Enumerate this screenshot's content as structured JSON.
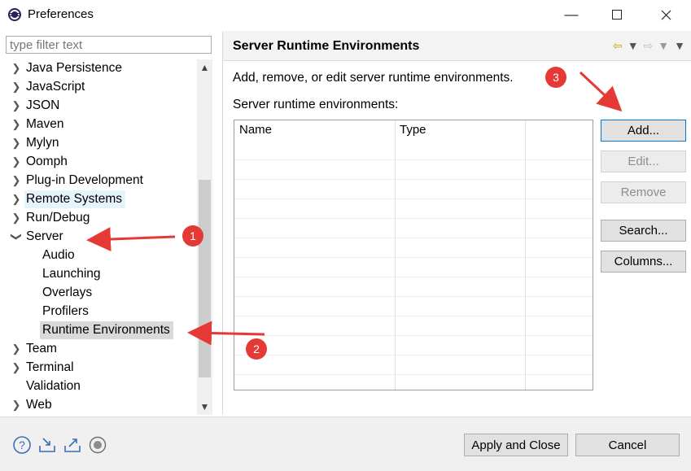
{
  "window": {
    "title": "Preferences",
    "controls": [
      "minimize-icon",
      "maximize-icon",
      "close-icon"
    ]
  },
  "filter": {
    "placeholder": "type filter text",
    "value": ""
  },
  "tree": {
    "items": [
      {
        "label": "Java Persistence",
        "expandable": true
      },
      {
        "label": "JavaScript",
        "expandable": true
      },
      {
        "label": "JSON",
        "expandable": true
      },
      {
        "label": "Maven",
        "expandable": true
      },
      {
        "label": "Mylyn",
        "expandable": true
      },
      {
        "label": "Oomph",
        "expandable": true
      },
      {
        "label": "Plug-in Development",
        "expandable": true
      },
      {
        "label": "Remote Systems",
        "expandable": true
      },
      {
        "label": "Run/Debug",
        "expandable": true
      },
      {
        "label": "Server",
        "expandable": true,
        "expanded": true
      },
      {
        "label": "Audio",
        "expandable": false
      },
      {
        "label": "Launching",
        "expandable": false
      },
      {
        "label": "Overlays",
        "expandable": false
      },
      {
        "label": "Profilers",
        "expandable": false
      },
      {
        "label": "Runtime Environments",
        "expandable": false,
        "selected": true
      },
      {
        "label": "Team",
        "expandable": true
      },
      {
        "label": "Terminal",
        "expandable": true
      },
      {
        "label": "Validation",
        "expandable": false
      },
      {
        "label": "Web",
        "expandable": true
      }
    ]
  },
  "page": {
    "title": "Server Runtime Environments",
    "description": "Add, remove, or edit server runtime environments.",
    "table_label": "Server runtime environments:",
    "columns": [
      "Name",
      "Type"
    ]
  },
  "buttons": {
    "add": "Add...",
    "edit": "Edit...",
    "remove": "Remove",
    "search": "Search...",
    "columns": "Columns..."
  },
  "footer": {
    "apply_and_close": "Apply and Close",
    "cancel": "Cancel",
    "icons": [
      "help-icon",
      "import-icon",
      "export-icon",
      "record-icon"
    ]
  },
  "annotations": {
    "badges": [
      "1",
      "2",
      "3"
    ],
    "color": "#e53935"
  }
}
